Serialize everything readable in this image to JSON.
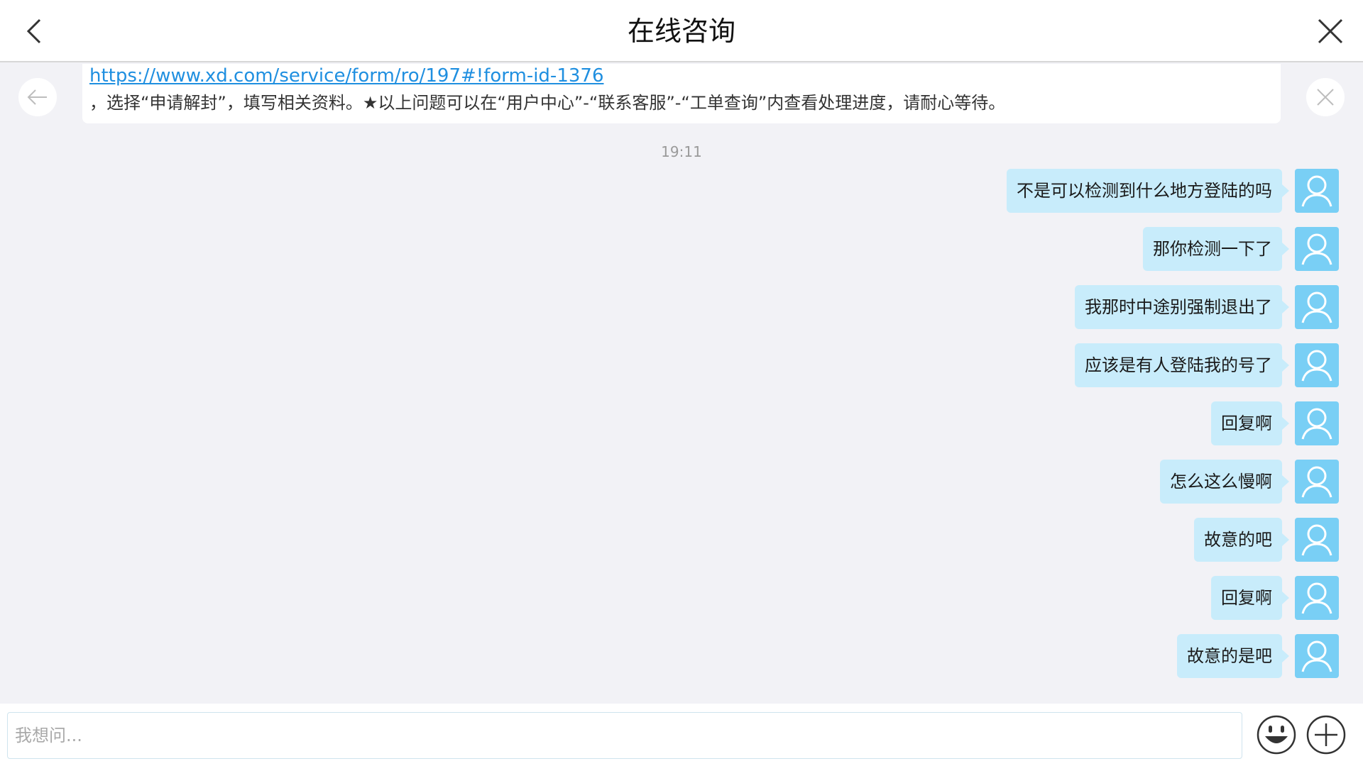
{
  "header": {
    "title": "在线咨询"
  },
  "previous_message": {
    "link": "https://www.xd.com/service/form/ro/197#!form-id-1376",
    "text": "，选择“申请解封”，填写相关资料。★以上问题可以在“用户中心”-“联系客服”-“工单查询”内查看处理进度，请耐心等待。"
  },
  "timestamp": "19:11",
  "messages": [
    {
      "text": "不是可以检测到什么地方登陆的吗"
    },
    {
      "text": "那你检测一下了"
    },
    {
      "text": "我那时中途别强制退出了"
    },
    {
      "text": "应该是有人登陆我的号了"
    },
    {
      "text": "回复啊"
    },
    {
      "text": "怎么这么慢啊"
    },
    {
      "text": "故意的吧"
    },
    {
      "text": "回复啊"
    },
    {
      "text": "故意的是吧"
    }
  ],
  "input": {
    "placeholder": "我想问...",
    "value": ""
  },
  "icons": {
    "back": "chevron-left-icon",
    "close": "close-icon",
    "avatar": "user-icon",
    "emoji": "emoji-icon",
    "plus": "plus-icon"
  },
  "colors": {
    "bubble": "#c8ecfb",
    "avatar": "#79cff5",
    "link": "#1f8fe0",
    "background": "#f2f2f6"
  }
}
